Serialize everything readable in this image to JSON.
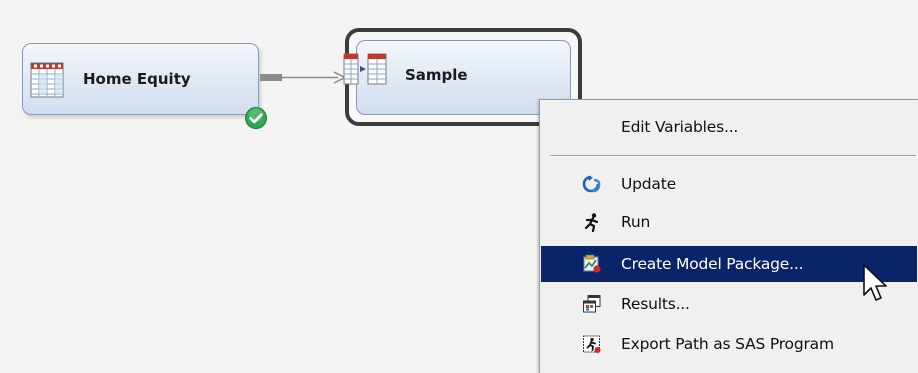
{
  "flow": {
    "nodes": [
      {
        "label": "Home Equity",
        "icon": "data-table-icon",
        "status": "completed-check-icon"
      },
      {
        "label": "Sample",
        "icon": "sample-table-icon",
        "selected": true
      }
    ],
    "connector": "arrow-connector"
  },
  "context_menu": {
    "items": [
      {
        "label": "Edit Variables...",
        "icon": null
      },
      {
        "label": "Update",
        "icon": "update-icon"
      },
      {
        "label": "Run",
        "icon": "run-icon"
      },
      {
        "label": "Create Model Package...",
        "icon": "model-package-icon",
        "highlighted": true
      },
      {
        "label": "Results...",
        "icon": "results-icon"
      },
      {
        "label": "Export Path as SAS Program",
        "icon": "export-sas-icon"
      }
    ]
  },
  "colors": {
    "highlight": "#0a246a",
    "menu_background": "#f0f0f0",
    "node_fill": "#dfe8f3",
    "node_border": "#8a9bb5",
    "check_green": "#2fa84f"
  }
}
